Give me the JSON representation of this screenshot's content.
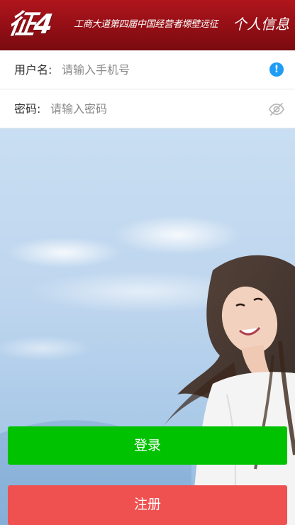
{
  "header": {
    "logo": "征4",
    "slogan": "工商大道第四届中国经营者塬壁远征",
    "profile_link": "个人信息"
  },
  "form": {
    "username": {
      "label": "用户名:",
      "placeholder": "请输入手机号",
      "value": "",
      "icon": "info-icon"
    },
    "password": {
      "label": "密码:",
      "placeholder": "请输入密码",
      "value": "",
      "icon": "eye-off-icon"
    }
  },
  "buttons": {
    "login": "登录",
    "register": "注册"
  },
  "colors": {
    "header": "#9a1016",
    "login": "#00c200",
    "register": "#ef5050",
    "info": "#1f9cf3"
  }
}
